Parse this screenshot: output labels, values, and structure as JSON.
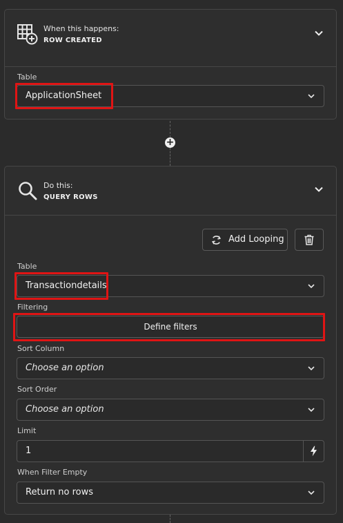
{
  "trigger": {
    "heading_small": "When this happens:",
    "heading_big": "ROW CREATED",
    "icon": "table-add-icon",
    "table_label": "Table",
    "table_value": "ApplicationSheet"
  },
  "connector": {
    "icon": "plus-icon"
  },
  "action": {
    "heading_small": "Do this:",
    "heading_big": "QUERY ROWS",
    "icon": "search-icon",
    "add_looping_label": "Add Looping",
    "table_label": "Table",
    "table_value": "Transactiondetails",
    "filtering_label": "Filtering",
    "define_filters_label": "Define filters",
    "sort_column_label": "Sort Column",
    "sort_column_placeholder": "Choose an option",
    "sort_order_label": "Sort Order",
    "sort_order_placeholder": "Choose an option",
    "limit_label": "Limit",
    "limit_value": "1",
    "when_filter_empty_label": "When Filter Empty",
    "when_filter_empty_value": "Return no rows"
  },
  "colors": {
    "highlight": "#e01414",
    "background": "#2b2b2b",
    "card": "#2e2e2e",
    "border": "#474747"
  }
}
